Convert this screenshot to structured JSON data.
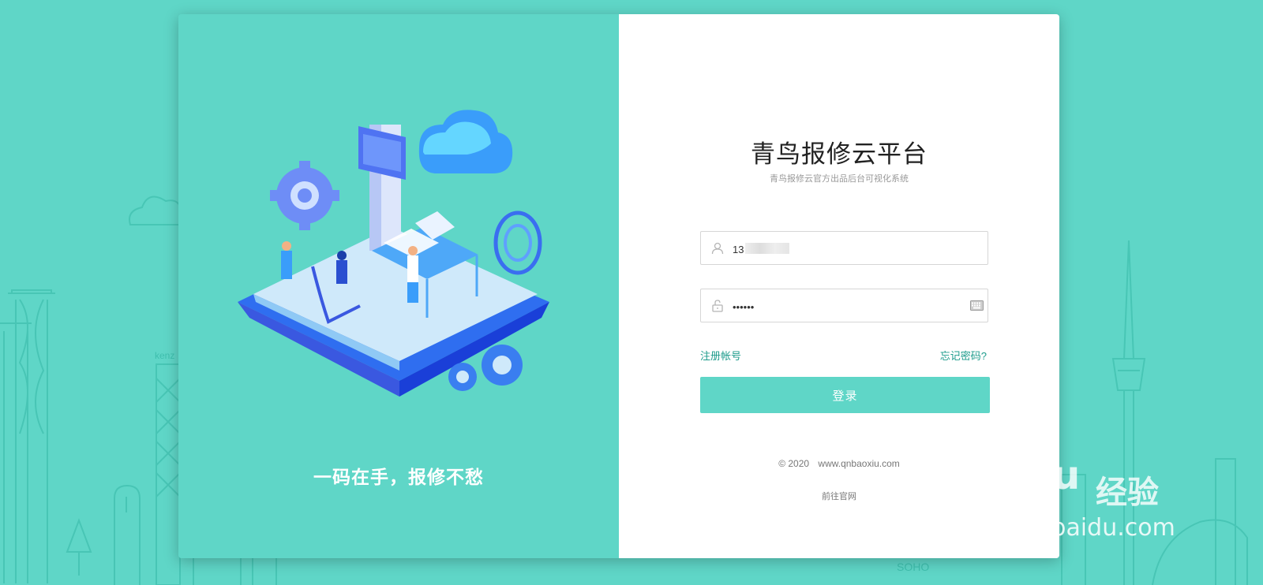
{
  "background": {
    "color": "#5fd6c7",
    "deco_labels": [
      "kenz",
      "SOHO"
    ]
  },
  "left_panel": {
    "slogan": "一码在手，报修不愁"
  },
  "login": {
    "title": "青鸟报修云平台",
    "subtitle": "青鸟报修云官方出品后台可视化系统",
    "username_value": "13",
    "password_value": "••••••",
    "register_link": "注册帐号",
    "forgot_link": "忘记密码?",
    "login_button": "登录",
    "copyright_year": "© 2020",
    "copyright_site": "www.qnbaoxiu.com",
    "site_link": "前往官网",
    "accent_color": "#5fd6c7",
    "link_color": "#1c9b8b"
  },
  "watermark": {
    "logo_text": "Baidu",
    "logo_cn": "经验",
    "url": "jingyan.baidu.com"
  }
}
